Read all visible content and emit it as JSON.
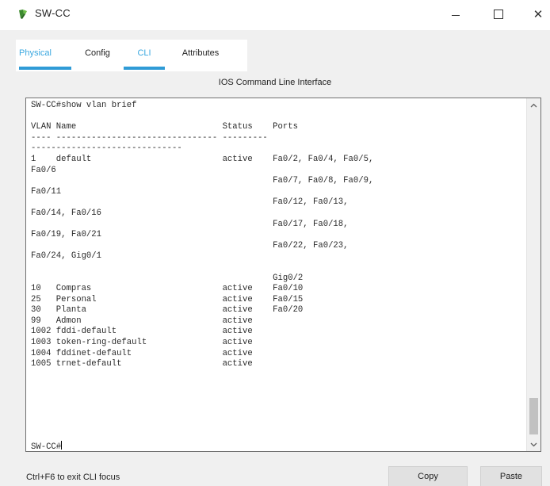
{
  "window": {
    "title": "SW-CC",
    "minimize_label": "—",
    "close_label": "✕"
  },
  "tabs": [
    {
      "label": "Physical"
    },
    {
      "label": "Config"
    },
    {
      "label": "CLI"
    },
    {
      "label": "Attributes"
    }
  ],
  "cli": {
    "heading": "IOS Command Line Interface",
    "output": "SW-CC#show vlan brief\n\nVLAN Name                             Status    Ports\n---- -------------------------------- ---------\n------------------------------\n1    default                          active    Fa0/2, Fa0/4, Fa0/5,\nFa0/6\n                                                Fa0/7, Fa0/8, Fa0/9,\nFa0/11\n                                                Fa0/12, Fa0/13,\nFa0/14, Fa0/16\n                                                Fa0/17, Fa0/18,\nFa0/19, Fa0/21\n                                                Fa0/22, Fa0/23,\nFa0/24, Gig0/1\n\n                                                Gig0/2\n10   Compras                          active    Fa0/10\n25   Personal                         active    Fa0/15\n30   Planta                           active    Fa0/20\n99   Admon                            active\n1002 fddi-default                     active\n1003 token-ring-default               active\n1004 fddinet-default                  active\n1005 trnet-default                    active",
    "prompt": "SW-CC#"
  },
  "footer": {
    "hint": "Ctrl+F6 to exit CLI focus",
    "copy_label": "Copy",
    "paste_label": "Paste"
  },
  "colors": {
    "tab_accent": "#2f9bd6",
    "tab_link_text": "#3ba8e0",
    "panel_bg": "#f0f0f0"
  },
  "icons": {
    "app": "switch-device-icon",
    "scroll_up": "chevron-up-icon",
    "scroll_down": "chevron-down-icon"
  }
}
